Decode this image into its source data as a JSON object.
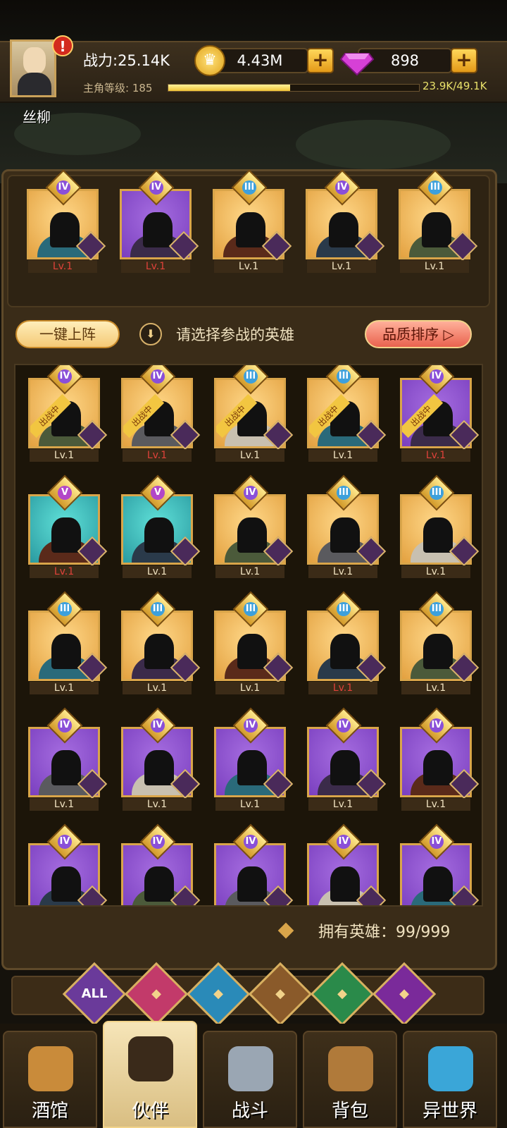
{
  "player": {
    "name": "丝柳",
    "power": "战力:25.14K",
    "level_label": "主角等级:",
    "level": "185",
    "xp": "23.9K/49.1K",
    "xp_fraction": 0.487
  },
  "currency": {
    "gold": "4.43M",
    "gems": "898",
    "plus": "+"
  },
  "team": [
    {
      "rank": "IV",
      "bg": "gold",
      "level": "Lv.1",
      "level_color": "red",
      "faction": "fighter"
    },
    {
      "rank": "IV",
      "bg": "purple",
      "level": "Lv.1",
      "level_color": "red",
      "faction": "fighter"
    },
    {
      "rank": "III",
      "bg": "gold",
      "level": "Lv.1",
      "level_color": "white",
      "faction": "fighter"
    },
    {
      "rank": "IV",
      "bg": "gold",
      "level": "Lv.1",
      "level_color": "white",
      "faction": "goblin"
    },
    {
      "rank": "III",
      "bg": "gold",
      "level": "Lv.1",
      "level_color": "white",
      "faction": "demon"
    }
  ],
  "actions": {
    "auto_deploy": "一键上阵",
    "hint": "请选择参战的英雄",
    "sort": "品质排序 ▷",
    "down_icon": "⬇"
  },
  "in_battle_label": "出战中",
  "heroes": [
    {
      "rank": "IV",
      "bg": "gold",
      "level": "Lv.1",
      "level_color": "white",
      "in_battle": true
    },
    {
      "rank": "IV",
      "bg": "gold",
      "level": "Lv.1",
      "level_color": "red",
      "in_battle": true
    },
    {
      "rank": "III",
      "bg": "gold",
      "level": "Lv.1",
      "level_color": "white",
      "in_battle": true
    },
    {
      "rank": "III",
      "bg": "gold",
      "level": "Lv.1",
      "level_color": "white",
      "in_battle": true
    },
    {
      "rank": "IV",
      "bg": "purple",
      "level": "Lv.1",
      "level_color": "red",
      "in_battle": true
    },
    {
      "rank": "V",
      "bg": "teal",
      "level": "Lv.1",
      "level_color": "red",
      "in_battle": false
    },
    {
      "rank": "V",
      "bg": "teal",
      "level": "Lv.1",
      "level_color": "white",
      "in_battle": false
    },
    {
      "rank": "IV",
      "bg": "gold",
      "level": "Lv.1",
      "level_color": "white",
      "in_battle": false
    },
    {
      "rank": "III",
      "bg": "gold",
      "level": "Lv.1",
      "level_color": "white",
      "in_battle": false
    },
    {
      "rank": "III",
      "bg": "gold",
      "level": "Lv.1",
      "level_color": "white",
      "in_battle": false
    },
    {
      "rank": "III",
      "bg": "gold",
      "level": "Lv.1",
      "level_color": "white",
      "in_battle": false
    },
    {
      "rank": "III",
      "bg": "gold",
      "level": "Lv.1",
      "level_color": "white",
      "in_battle": false
    },
    {
      "rank": "III",
      "bg": "gold",
      "level": "Lv.1",
      "level_color": "white",
      "in_battle": false
    },
    {
      "rank": "III",
      "bg": "gold",
      "level": "Lv.1",
      "level_color": "red",
      "in_battle": false
    },
    {
      "rank": "III",
      "bg": "gold",
      "level": "Lv.1",
      "level_color": "white",
      "in_battle": false
    },
    {
      "rank": "IV",
      "bg": "purple",
      "level": "Lv.1",
      "level_color": "white",
      "in_battle": false
    },
    {
      "rank": "IV",
      "bg": "purple",
      "level": "Lv.1",
      "level_color": "white",
      "in_battle": false
    },
    {
      "rank": "IV",
      "bg": "purple",
      "level": "Lv.1",
      "level_color": "white",
      "in_battle": false
    },
    {
      "rank": "IV",
      "bg": "purple",
      "level": "Lv.1",
      "level_color": "white",
      "in_battle": false
    },
    {
      "rank": "IV",
      "bg": "purple",
      "level": "Lv.1",
      "level_color": "white",
      "in_battle": false
    },
    {
      "rank": "IV",
      "bg": "purple",
      "level": "",
      "level_color": "white",
      "in_battle": false
    },
    {
      "rank": "IV",
      "bg": "purple",
      "level": "",
      "level_color": "white",
      "in_battle": false
    },
    {
      "rank": "IV",
      "bg": "purple",
      "level": "",
      "level_color": "white",
      "in_battle": false
    },
    {
      "rank": "IV",
      "bg": "purple",
      "level": "",
      "level_color": "white",
      "in_battle": false
    },
    {
      "rank": "IV",
      "bg": "purple",
      "level": "",
      "level_color": "white",
      "in_battle": false
    }
  ],
  "hero_count": "拥有英雄：99/999",
  "filters": [
    {
      "label": "ALL",
      "icon": "all-icon",
      "color": "#6a3a9a"
    },
    {
      "label": "",
      "icon": "fighter-icon",
      "color": "#c23a6a"
    },
    {
      "label": "",
      "icon": "goblin-icon",
      "color": "#2a8ab8"
    },
    {
      "label": "",
      "icon": "lion-icon",
      "color": "#8a5a2a"
    },
    {
      "label": "",
      "icon": "elf-icon",
      "color": "#2a8a4a"
    },
    {
      "label": "",
      "icon": "demon-icon",
      "color": "#7a2a9a"
    }
  ],
  "nav": [
    {
      "label": "酒馆",
      "icon": "tavern-icon",
      "active": false,
      "color": "#c98b3a"
    },
    {
      "label": "伙伴",
      "icon": "partner-icon",
      "active": true,
      "color": "#3a2a1a"
    },
    {
      "label": "战斗",
      "icon": "battle-icon",
      "active": false,
      "color": "#9aa6b3"
    },
    {
      "label": "背包",
      "icon": "backpack-icon",
      "active": false,
      "color": "#b07a3a"
    },
    {
      "label": "异世界",
      "icon": "portal-icon",
      "active": false,
      "color": "#3aa6d8"
    }
  ]
}
